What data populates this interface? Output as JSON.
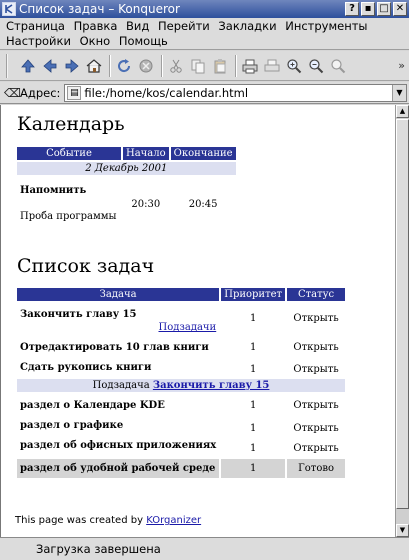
{
  "window": {
    "title": "Список задач – Konqueror",
    "buttons": [
      "?",
      "▪",
      "□",
      "✕"
    ]
  },
  "menu": {
    "items": [
      "Страница",
      "Правка",
      "Вид",
      "Перейти",
      "Закладки",
      "Инструменты",
      "Настройки",
      "Окно",
      "Помощь"
    ]
  },
  "toolbar": {
    "icons": [
      "up-arrow-icon",
      "back-icon",
      "forward-icon",
      "home-icon",
      "reload-icon",
      "stop-icon",
      "cut-icon",
      "copy-icon",
      "paste-icon",
      "print-icon",
      "print-frame-icon",
      "zoom-in-icon",
      "zoom-out-icon",
      "zoom-icon"
    ],
    "more": "»"
  },
  "location": {
    "label": "Адрес:",
    "value": "file:/home/kos/calendar.html"
  },
  "calendar": {
    "heading": "Календарь",
    "headers": [
      "Событие",
      "Начало",
      "Окончание"
    ],
    "date": "2 Декабрь 2001",
    "events": [
      {
        "name": "Напомнить",
        "start": "",
        "end": ""
      },
      {
        "name": "Проба программы",
        "start": "20:30",
        "end": "20:45"
      }
    ]
  },
  "tasks": {
    "heading": "Список задач",
    "headers": [
      "Задача",
      "Приоритет",
      "Статус"
    ],
    "rows": [
      {
        "task": "Закончить главу 15",
        "link": "Подзадачи",
        "priority": "1",
        "status": "Открыть"
      },
      {
        "task": "Отредактировать 10 глав книги",
        "priority": "1",
        "status": "Открыть"
      },
      {
        "task": "Сдать рукопись книги",
        "priority": "1",
        "status": "Открыть"
      }
    ],
    "subtask_label": "Подзадача",
    "subtask_link": "Закончить главу 15",
    "subrows": [
      {
        "task": "раздел о Календаре KDE",
        "priority": "1",
        "status": "Открыть"
      },
      {
        "task": "раздел о графике",
        "priority": "1",
        "status": "Открыть"
      },
      {
        "task": "раздел об офисных приложениях",
        "priority": "1",
        "status": "Открыть"
      },
      {
        "task": "раздел об удобной рабочей среде",
        "priority": "1",
        "status": "Готово"
      }
    ]
  },
  "footer": {
    "text": "This page was created by",
    "link": "KOrganizer"
  },
  "status": {
    "text": "Загрузка завершена"
  }
}
